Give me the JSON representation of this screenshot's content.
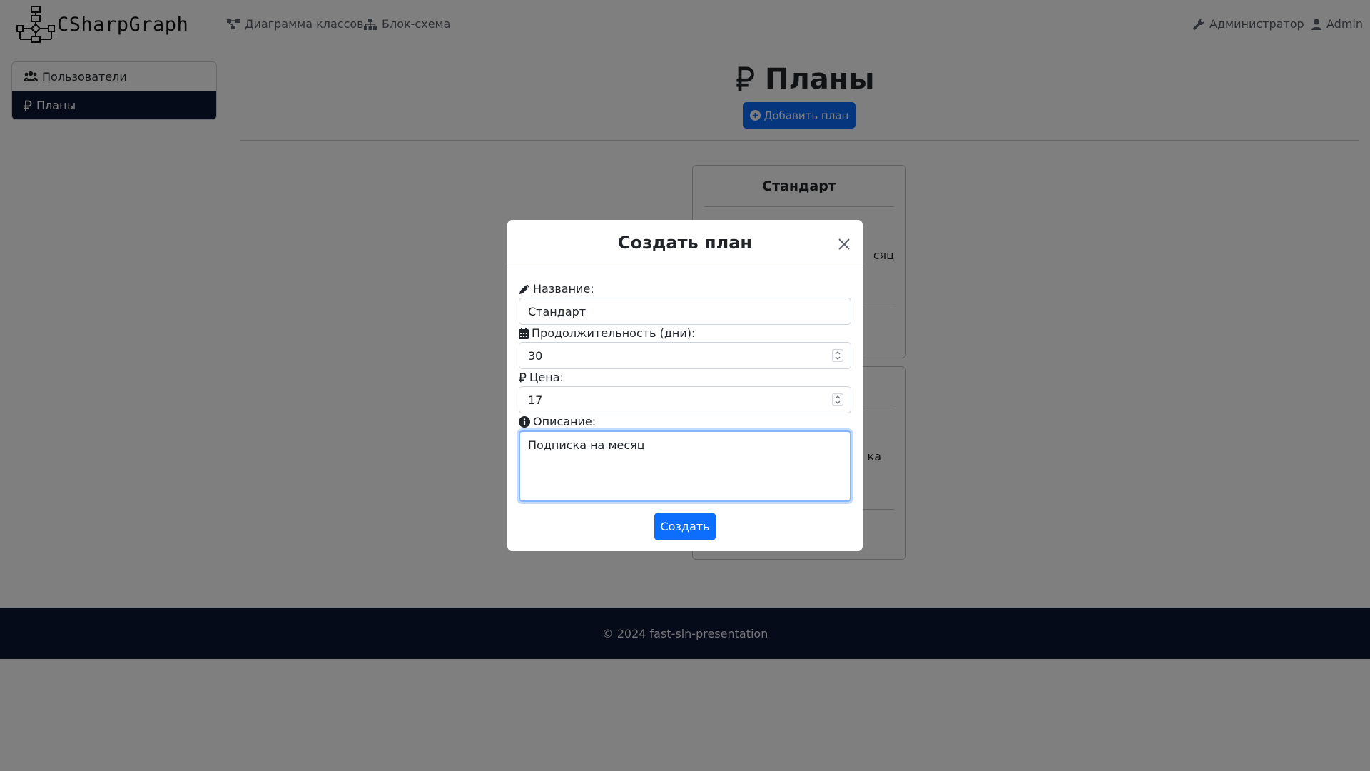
{
  "navbar": {
    "brand": "CSharpGraph",
    "links": [
      {
        "label": "Диаграмма классов",
        "icon": "diagram-icon"
      },
      {
        "label": "Блок-схема",
        "icon": "sitemap-icon"
      }
    ],
    "admin_link": {
      "label": "Администратор",
      "icon": "wrench-icon"
    },
    "user_link": {
      "label": "Admin",
      "icon": "user-icon"
    }
  },
  "sidebar": {
    "items": [
      {
        "label": "Пользователи",
        "icon": "users-icon",
        "active": false
      },
      {
        "label": "Планы",
        "icon": "ruble-icon",
        "active": true
      }
    ]
  },
  "main": {
    "title": "Планы",
    "add_button": "Добавить план",
    "cards": [
      {
        "title": "Стандарт",
        "description_visible_fragment": "сяц"
      },
      {
        "title": "",
        "description_visible_fragment": "ка"
      }
    ]
  },
  "footer": {
    "text": "© 2024 fast-sln-presentation"
  },
  "modal": {
    "title": "Создать план",
    "fields": {
      "name": {
        "label": "Название:",
        "value": "Стандарт",
        "icon": "pencil-icon"
      },
      "duration": {
        "label": "Продолжительность (дни):",
        "value": "30",
        "icon": "calendar-icon"
      },
      "price": {
        "label": "Цена:",
        "value": "17",
        "icon": "ruble-icon"
      },
      "description": {
        "label": "Описание:",
        "value": "Подписка на месяц",
        "icon": "info-icon"
      }
    },
    "submit": "Создать"
  },
  "colors": {
    "primary": "#0d6efd",
    "dark_navy": "#0c1733",
    "backdrop": "rgba(0,0,0,0.5)"
  }
}
